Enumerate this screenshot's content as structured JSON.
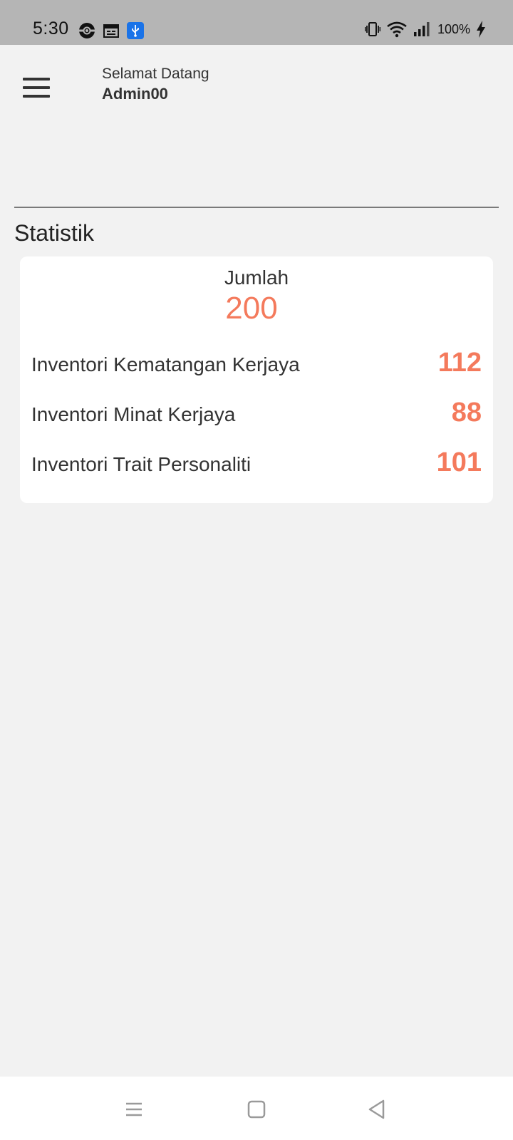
{
  "status_bar": {
    "time": "5:30",
    "battery": "100%",
    "left_icons": [
      "pokeball-icon",
      "calendar-icon",
      "usb-icon"
    ],
    "right_icons": [
      "vibrate-icon",
      "wifi-icon",
      "signal-icon",
      "charging-icon"
    ]
  },
  "header": {
    "welcome": "Selamat Datang",
    "username": "Admin00",
    "menu_icon": "hamburger-menu-icon"
  },
  "statistics": {
    "section_title": "Statistik",
    "total_label": "Jumlah",
    "total_value": "200",
    "rows": [
      {
        "label": "Inventori Kematangan Kerjaya",
        "value": "112"
      },
      {
        "label": "Inventori Minat Kerjaya",
        "value": "88"
      },
      {
        "label": "Inventori Trait Personaliti",
        "value": "101"
      }
    ]
  },
  "navigation": {
    "icons": [
      "recents-icon",
      "home-icon",
      "back-icon"
    ]
  },
  "colors": {
    "accent": "#f47a5c",
    "status_bar": "#b5b5b5",
    "background": "#f2f2f2"
  }
}
